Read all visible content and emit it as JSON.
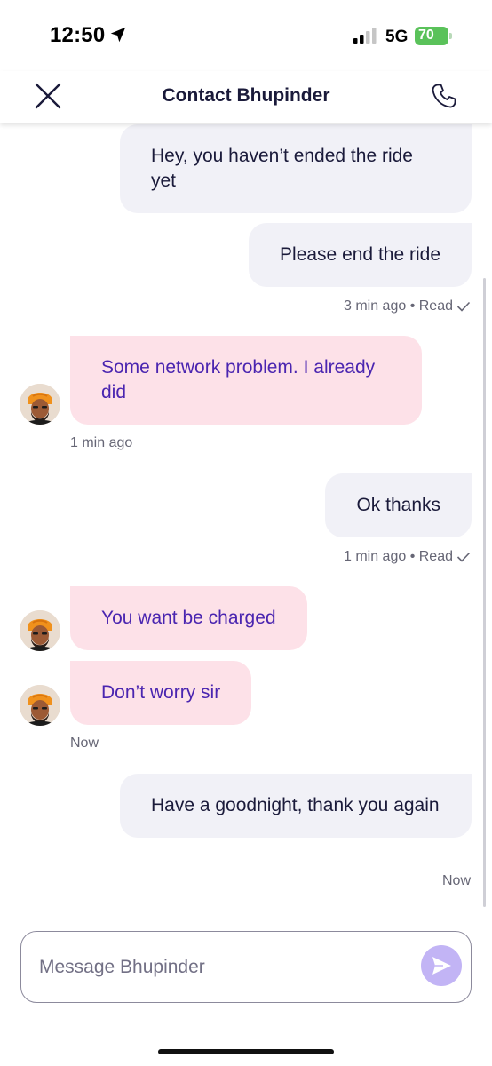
{
  "status_bar": {
    "time": "12:50",
    "network": "5G",
    "battery": "70",
    "icons": [
      "location-arrow-icon",
      "signal-bars-icon",
      "battery-charging-icon"
    ]
  },
  "header": {
    "title": "Contact Bhupinder",
    "icons": [
      "close-icon",
      "phone-icon"
    ]
  },
  "messages": [
    {
      "direction": "out",
      "text": "Hey, you haven’t ended the ride yet"
    },
    {
      "direction": "out",
      "text": "Please end the ride",
      "meta": "3 min ago • Read"
    },
    {
      "direction": "in",
      "text": "Some network problem. I already did",
      "meta": "1 min ago"
    },
    {
      "direction": "out",
      "text": "Ok thanks",
      "meta": "1 min ago • Read"
    },
    {
      "direction": "in",
      "text": "You want be charged"
    },
    {
      "direction": "in",
      "text": "Don’t worry sir",
      "meta": "Now"
    },
    {
      "direction": "out",
      "text": "Have a goodnight, thank you again",
      "meta": "Now"
    }
  ],
  "composer": {
    "placeholder": "Message Bhupinder",
    "icons": [
      "send-icon"
    ]
  },
  "colors": {
    "outgoing_bubble": "#f1f1f7",
    "incoming_bubble": "#fde1e8",
    "incoming_text": "#4a25b0",
    "send_button": "#c2b4f5",
    "battery": "#5ac25a"
  }
}
